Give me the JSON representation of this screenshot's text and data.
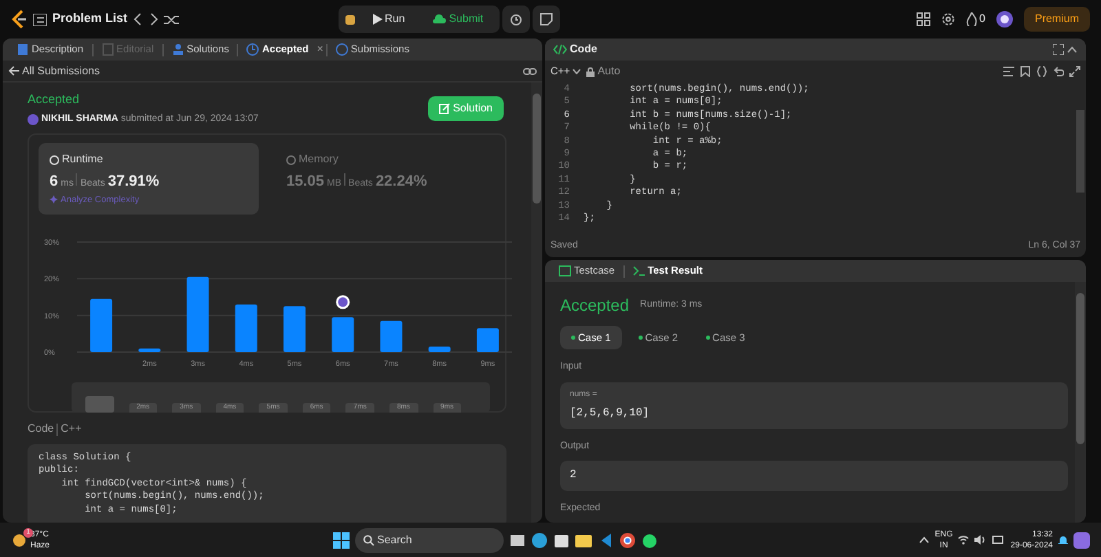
{
  "topbar": {
    "title": "Problem List",
    "run": "Run",
    "submit": "Submit",
    "streak": "0",
    "premium": "Premium"
  },
  "left_tabs": [
    {
      "label": "Description",
      "selected": false,
      "disabled": false
    },
    {
      "label": "Editorial",
      "selected": false,
      "disabled": true
    },
    {
      "label": "Solutions",
      "selected": false,
      "disabled": false
    },
    {
      "label": "Accepted",
      "selected": true,
      "disabled": false,
      "close": "×"
    },
    {
      "label": "Submissions",
      "selected": false,
      "disabled": false
    }
  ],
  "back_link": "All Submissions",
  "submission": {
    "status": "Accepted",
    "user": "NIKHIL SHARMA",
    "submitted": "submitted at Jun 29, 2024 13:07",
    "solution_button": "Solution"
  },
  "stats": [
    {
      "title": "Runtime",
      "selected": true,
      "value": "6",
      "unit": "ms",
      "beats_label": "Beats",
      "beats": "37.91%",
      "link": "Analyze Complexity"
    },
    {
      "title": "Memory",
      "selected": false,
      "value": "15.05",
      "unit": "MB",
      "beats_label": "Beats",
      "beats": "22.24%"
    }
  ],
  "chart": {
    "chart_data": {
      "type": "bar",
      "categories": [
        null,
        "2ms",
        "3ms",
        "4ms",
        "5ms",
        "6ms",
        "7ms",
        "8ms",
        "9ms"
      ],
      "values": [
        14.5,
        1,
        20.5,
        13,
        12.5,
        9.5,
        8.5,
        1.5,
        6.5
      ],
      "ylim": [
        0,
        30
      ],
      "yticks": [
        {
          "value": 0,
          "label": "0%"
        },
        {
          "value": 10,
          "label": "10%"
        },
        {
          "value": 20,
          "label": "20%"
        },
        {
          "value": 30,
          "label": "30%"
        }
      ]
    },
    "navigator_labels": [
      "2ms",
      "3ms",
      "4ms",
      "5ms",
      "6ms",
      "7ms",
      "8ms",
      "9ms"
    ]
  },
  "code_section": {
    "label": "Code",
    "language": "C++",
    "lines": [
      "class Solution {",
      "public:",
      "    int findGCD(vector<int>& nums) {",
      "        sort(nums.begin(), nums.end());",
      "        int a = nums[0];"
    ]
  },
  "editor": {
    "title": "Code",
    "language": "C++",
    "mode": "Auto",
    "lines": [
      {
        "no": "4",
        "text": "        sort(nums.begin(), nums.end());",
        "selected": false
      },
      {
        "no": "5",
        "text": "        int a = nums[0];",
        "selected": false
      },
      {
        "no": "6",
        "text": "        int b = nums[nums.size()-1];",
        "selected": true
      },
      {
        "no": "7",
        "text": "        while(b != 0){",
        "selected": false
      },
      {
        "no": "8",
        "text": "            int r = a%b;",
        "selected": false
      },
      {
        "no": "9",
        "text": "            a = b;",
        "selected": false
      },
      {
        "no": "10",
        "text": "            b = r;",
        "selected": false
      },
      {
        "no": "11",
        "text": "        }",
        "selected": false
      },
      {
        "no": "12",
        "text": "        return a;",
        "selected": false
      },
      {
        "no": "13",
        "text": "    }",
        "selected": false
      },
      {
        "no": "14",
        "text": "};",
        "selected": false
      }
    ],
    "status": "Saved",
    "cursor": "Ln 6, Col 37"
  },
  "test_tabs": [
    {
      "label": "Testcase",
      "selected": false
    },
    {
      "label": "Test Result",
      "selected": true
    }
  ],
  "result": {
    "status": "Accepted",
    "runtime": "Runtime: 3 ms",
    "cases": [
      {
        "label": "Case 1",
        "selected": true
      },
      {
        "label": "Case 2",
        "selected": false
      },
      {
        "label": "Case 3",
        "selected": false
      }
    ],
    "input_label": "Input",
    "var_name": "nums =",
    "input_value": "[2,5,6,9,10]",
    "output_label": "Output",
    "output_value": "2",
    "expected_label": "Expected"
  },
  "taskbar": {
    "temperature": "37°C",
    "weather": "Haze",
    "weather_badge": "1",
    "search": "Search",
    "lang": "ENG",
    "region": "IN",
    "time": "13:32",
    "date": "29-06-2024"
  }
}
